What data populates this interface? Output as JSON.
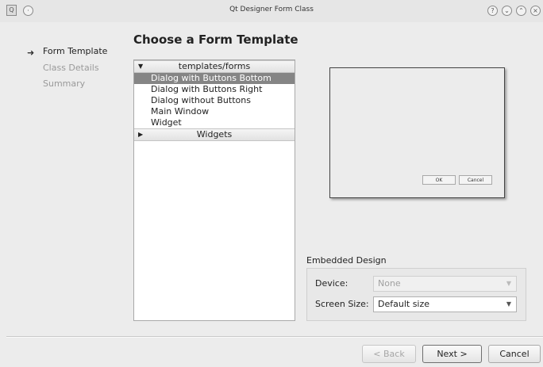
{
  "window": {
    "title": "Qt Designer Form Class",
    "app_icon": "qt-app-icon",
    "controls": [
      "help-icon",
      "minimize-icon",
      "maximize-icon",
      "close-icon"
    ],
    "control_glyphs": {
      "help": "?",
      "minimize": "⌄",
      "maximize": "⌃",
      "close": "×"
    }
  },
  "steps": [
    {
      "label": "Form Template",
      "active": true
    },
    {
      "label": "Class Details",
      "active": false
    },
    {
      "label": "Summary",
      "active": false
    }
  ],
  "heading": "Choose a Form Template",
  "templates": {
    "categories": [
      {
        "label": "templates/forms",
        "expanded": true,
        "items": [
          {
            "label": "Dialog with Buttons Bottom",
            "selected": true
          },
          {
            "label": "Dialog with Buttons Right",
            "selected": false
          },
          {
            "label": "Dialog without Buttons",
            "selected": false
          },
          {
            "label": "Main Window",
            "selected": false
          },
          {
            "label": "Widget",
            "selected": false
          }
        ]
      },
      {
        "label": "Widgets",
        "expanded": false,
        "items": []
      }
    ]
  },
  "preview": {
    "ok_label": "OK",
    "cancel_label": "Cancel"
  },
  "embedded_design": {
    "title": "Embedded Design",
    "device_label": "Device:",
    "device_value": "None",
    "screen_size_label": "Screen Size:",
    "screen_size_value": "Default size"
  },
  "buttons": {
    "back": "< Back",
    "next": "Next >",
    "cancel": "Cancel"
  },
  "colors": {
    "selection": "#858585",
    "window_bg": "#ececec"
  }
}
